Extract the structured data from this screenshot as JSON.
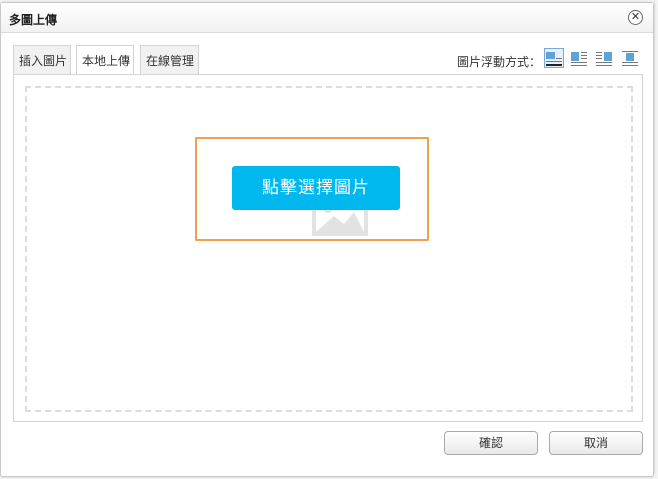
{
  "dialog": {
    "title": "多圖上傳",
    "close_glyph": "✕"
  },
  "tabs": [
    {
      "label": "插入圖片",
      "active": false
    },
    {
      "label": "本地上傳",
      "active": true
    },
    {
      "label": "在線管理",
      "active": false
    }
  ],
  "float": {
    "label": "圖片浮動方式：",
    "options": [
      {
        "icon": "align-none-icon",
        "selected": true
      },
      {
        "icon": "align-left-icon",
        "selected": false
      },
      {
        "icon": "align-right-icon",
        "selected": false
      },
      {
        "icon": "align-center-icon",
        "selected": false
      }
    ]
  },
  "upload": {
    "pick_label": "點擊選擇圖片",
    "icon": "image-add-icon"
  },
  "footer": {
    "ok_label": "確認",
    "cancel_label": "取消"
  },
  "colors": {
    "accent": "#00b7ee",
    "highlight": "#f0a050"
  }
}
